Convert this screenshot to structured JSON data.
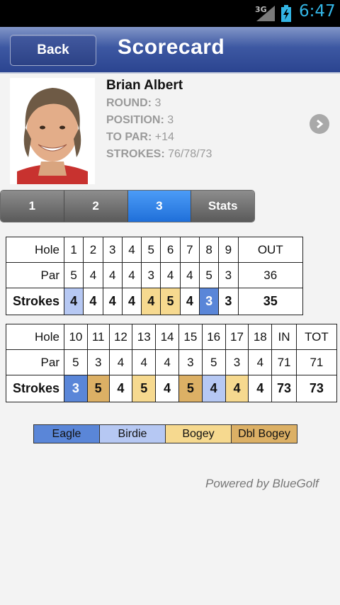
{
  "status_bar": {
    "network": "3G",
    "time": "6:47"
  },
  "header": {
    "back_label": "Back",
    "title": "Scorecard"
  },
  "player": {
    "name": "Brian Albert",
    "round_label": "ROUND:",
    "round_value": "3",
    "position_label": "POSITION:",
    "position_value": "3",
    "topar_label": "TO PAR:",
    "topar_value": "+14",
    "strokes_label": "STROKES:",
    "strokes_value": "76/78/73"
  },
  "tabs": [
    {
      "label": "1",
      "active": false
    },
    {
      "label": "2",
      "active": false
    },
    {
      "label": "3",
      "active": true
    },
    {
      "label": "Stats",
      "active": false
    }
  ],
  "front_nine": {
    "hole_label": "Hole",
    "par_label": "Par",
    "strokes_label": "Strokes",
    "holes": [
      "1",
      "2",
      "3",
      "4",
      "5",
      "6",
      "7",
      "8",
      "9",
      "OUT"
    ],
    "par": [
      "5",
      "4",
      "4",
      "4",
      "3",
      "4",
      "4",
      "5",
      "3",
      "36"
    ],
    "strokes": [
      "4",
      "4",
      "4",
      "4",
      "4",
      "5",
      "4",
      "3",
      "3",
      "35"
    ],
    "result": [
      "birdie",
      "",
      "",
      "",
      "bogey",
      "bogey",
      "",
      "eagle",
      "",
      ""
    ]
  },
  "back_nine": {
    "hole_label": "Hole",
    "par_label": "Par",
    "strokes_label": "Strokes",
    "holes": [
      "10",
      "11",
      "12",
      "13",
      "14",
      "15",
      "16",
      "17",
      "18",
      "IN",
      "TOT"
    ],
    "par": [
      "5",
      "3",
      "4",
      "4",
      "4",
      "3",
      "5",
      "3",
      "4",
      "71",
      "71"
    ],
    "strokes": [
      "3",
      "5",
      "4",
      "5",
      "4",
      "5",
      "4",
      "4",
      "4",
      "73",
      "73"
    ],
    "result": [
      "eagle",
      "dbl",
      "",
      "bogey",
      "",
      "dbl",
      "birdie",
      "bogey",
      "",
      "",
      ""
    ]
  },
  "legend": [
    {
      "label": "Eagle",
      "color": "#5a86d8"
    },
    {
      "label": "Birdie",
      "color": "#b6c8f3"
    },
    {
      "label": "Bogey",
      "color": "#f6d98f"
    },
    {
      "label": "Dbl Bogey",
      "color": "#dcb065"
    }
  ],
  "footer": {
    "powered_by": "Powered by BlueGolf"
  },
  "colors": {
    "header_blue": "#3d58a2",
    "tab_active": "#1f6fd9",
    "time": "#33b5e5"
  }
}
